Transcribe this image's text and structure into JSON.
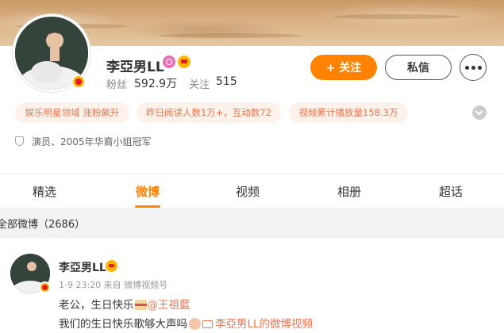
{
  "profile": {
    "name": "李亞男LL",
    "fans_label": "粉丝",
    "fans_value": "592.9万",
    "following_label": "关注",
    "following_value": "515",
    "follow_button": "+ 关注",
    "message_button": "私信",
    "tags": [
      "娱乐明星领域 涨粉飙升",
      "昨日阅读人数1万+，互动数72",
      "视频累计播放量158.3万"
    ],
    "bio": "演员、2005年华裔小姐冠军"
  },
  "tabs": [
    "精选",
    "微博",
    "视频",
    "相册",
    "超话"
  ],
  "active_tab": "微博",
  "all_posts_label": "全部微博（2686）",
  "post": {
    "author": "李亞男LL",
    "meta": "1-9 23:20 来自 微博视频号",
    "line1_text": "老公，生日快乐",
    "line1_mention": "@王祖藍",
    "line2_text": "我们的生日快乐歌够大声吗",
    "line2_link": "李亞男LL的微博视频"
  },
  "colors": {
    "accent": "#ff8200",
    "link": "#eb7350",
    "tag_bg": "#fdf2e9"
  }
}
